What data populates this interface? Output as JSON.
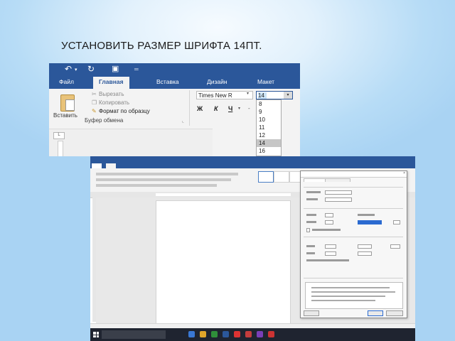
{
  "slide": {
    "title": "УСТАНОВИТЬ РАЗМЕР ШРИФТА 14ПТ."
  },
  "ribbon": {
    "tabs": [
      "Файл",
      "Главная",
      "Вставка",
      "Дизайн",
      "Макет"
    ],
    "active_tab": "Главная",
    "clipboard": {
      "paste": "Вставить",
      "cut": "Вырезать",
      "copy": "Копировать",
      "format_painter": "Формат по образцу",
      "group_label": "Буфер обмена"
    },
    "font_name": "Times New R",
    "font_size": "14",
    "format_buttons": [
      "Ж",
      "К",
      "Ч"
    ],
    "size_options": [
      "8",
      "9",
      "10",
      "11",
      "12",
      "14",
      "16"
    ],
    "selected_size": "14",
    "ruler_marker": "L"
  },
  "accent_color": "#2b579a"
}
